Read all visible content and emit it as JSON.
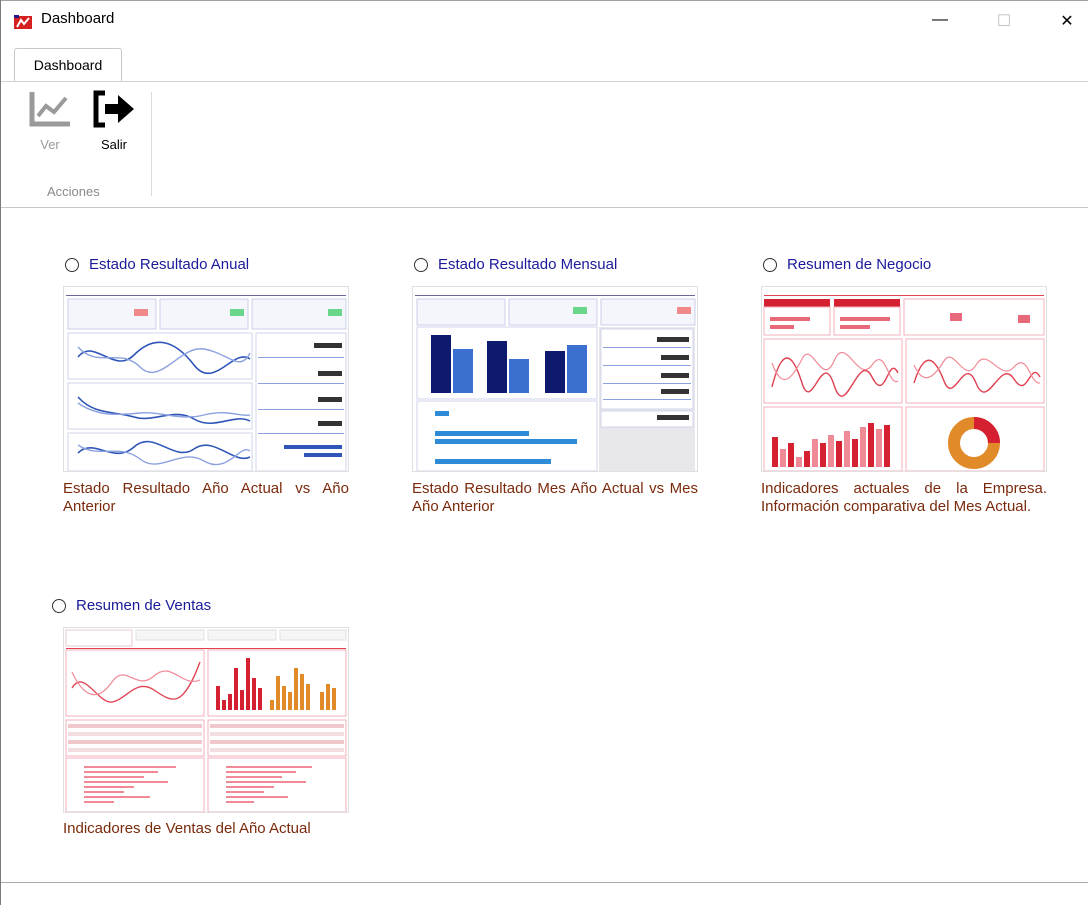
{
  "window": {
    "title": "Dashboard",
    "minimize": "—",
    "maximize": "☐",
    "close": "✕"
  },
  "tabs": [
    {
      "label": "Dashboard"
    }
  ],
  "ribbon": {
    "buttons": [
      {
        "label": "Ver"
      },
      {
        "label": "Salir"
      }
    ],
    "group_label": "Acciones"
  },
  "reports": [
    {
      "title": "Estado Resultado Anual",
      "description": "Estado Resultado Año Actual vs Año Anterior"
    },
    {
      "title": "Estado Resultado Mensual",
      "description": "Estado Resultado Mes Año Actual vs Mes Año Anterior"
    },
    {
      "title": "Resumen de Negocio",
      "description": "Indicadores actuales de la Empresa. Información comparativa del Mes Actual."
    },
    {
      "title": "Resumen de Ventas",
      "description": "Indicadores de Ventas del Año Actual"
    }
  ],
  "colors": {
    "link": "#1a1a9a",
    "description": "#7a2a0c",
    "navy": "#0d1a6e",
    "blue": "#3b6fd0",
    "red": "#e0445a",
    "orange": "#e08a2a"
  }
}
